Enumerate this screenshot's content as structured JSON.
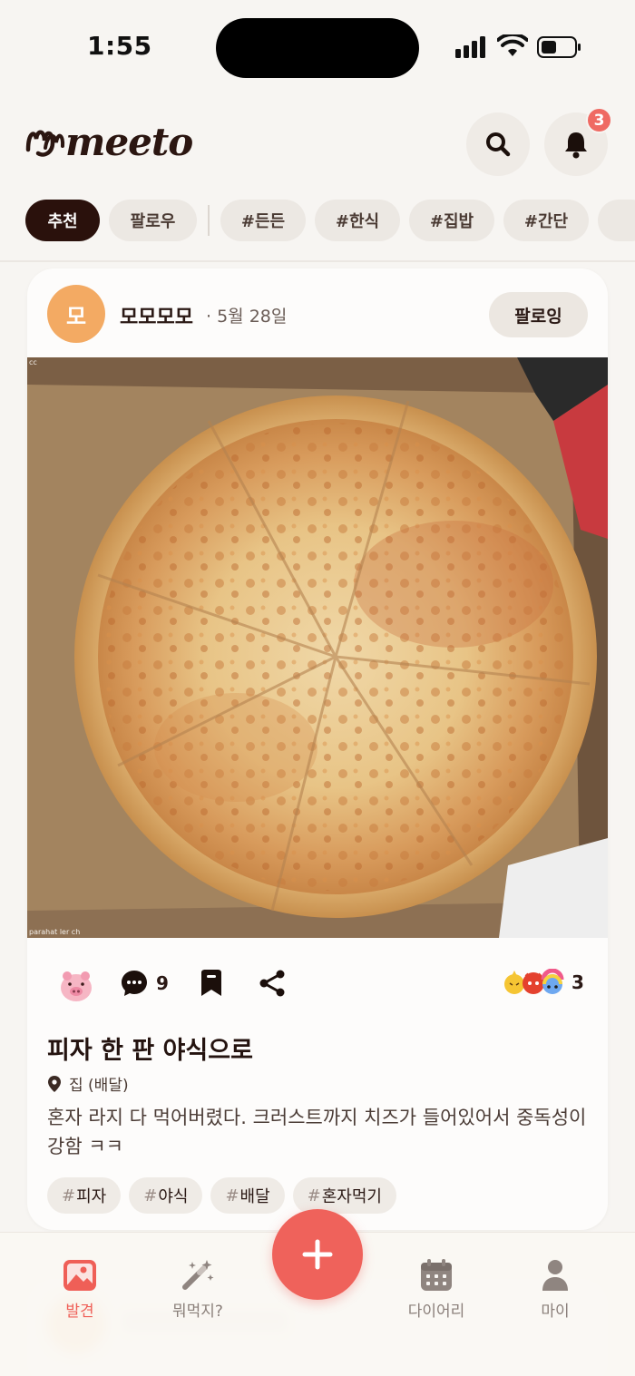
{
  "status_bar": {
    "time": "1:55"
  },
  "header": {
    "logo_text": "meeto",
    "notification_count": "3"
  },
  "filters": {
    "primary": [
      {
        "label": "추천",
        "active": true
      },
      {
        "label": "팔로우",
        "active": false
      }
    ],
    "tags": [
      "#든든",
      "#한식",
      "#집밥",
      "#간단"
    ]
  },
  "post": {
    "author_initial": "모",
    "author_name": "모모모모",
    "date": "5월 28일",
    "follow_label": "팔로잉",
    "photo_caption_top": "cc",
    "photo_caption_bottom": "parahat ler ch",
    "comment_count": "9",
    "reaction_count": "3",
    "title": "피자 한 판 야식으로",
    "location": "집 (배달)",
    "body": "혼자 라지 다 먹어버렸다. 크러스트까지 치즈가 들어있어서 중독성이 강함 ㅋㅋ",
    "tags": [
      "피자",
      "야식",
      "배달",
      "혼자먹기"
    ]
  },
  "bottom_nav": {
    "items": [
      {
        "label": "발견",
        "icon": "image-icon",
        "active": true
      },
      {
        "label": "뭐먹지?",
        "icon": "magic-wand-icon",
        "active": false
      },
      {
        "label": "다이어리",
        "icon": "calendar-icon",
        "active": false
      },
      {
        "label": "마이",
        "icon": "person-icon",
        "active": false
      }
    ],
    "fab_icon": "plus-icon"
  },
  "colors": {
    "accent": "#ef625b",
    "chip_active_bg": "#2a110c",
    "avatar_bg": "#f3aa63",
    "background": "#f7f5f2"
  }
}
